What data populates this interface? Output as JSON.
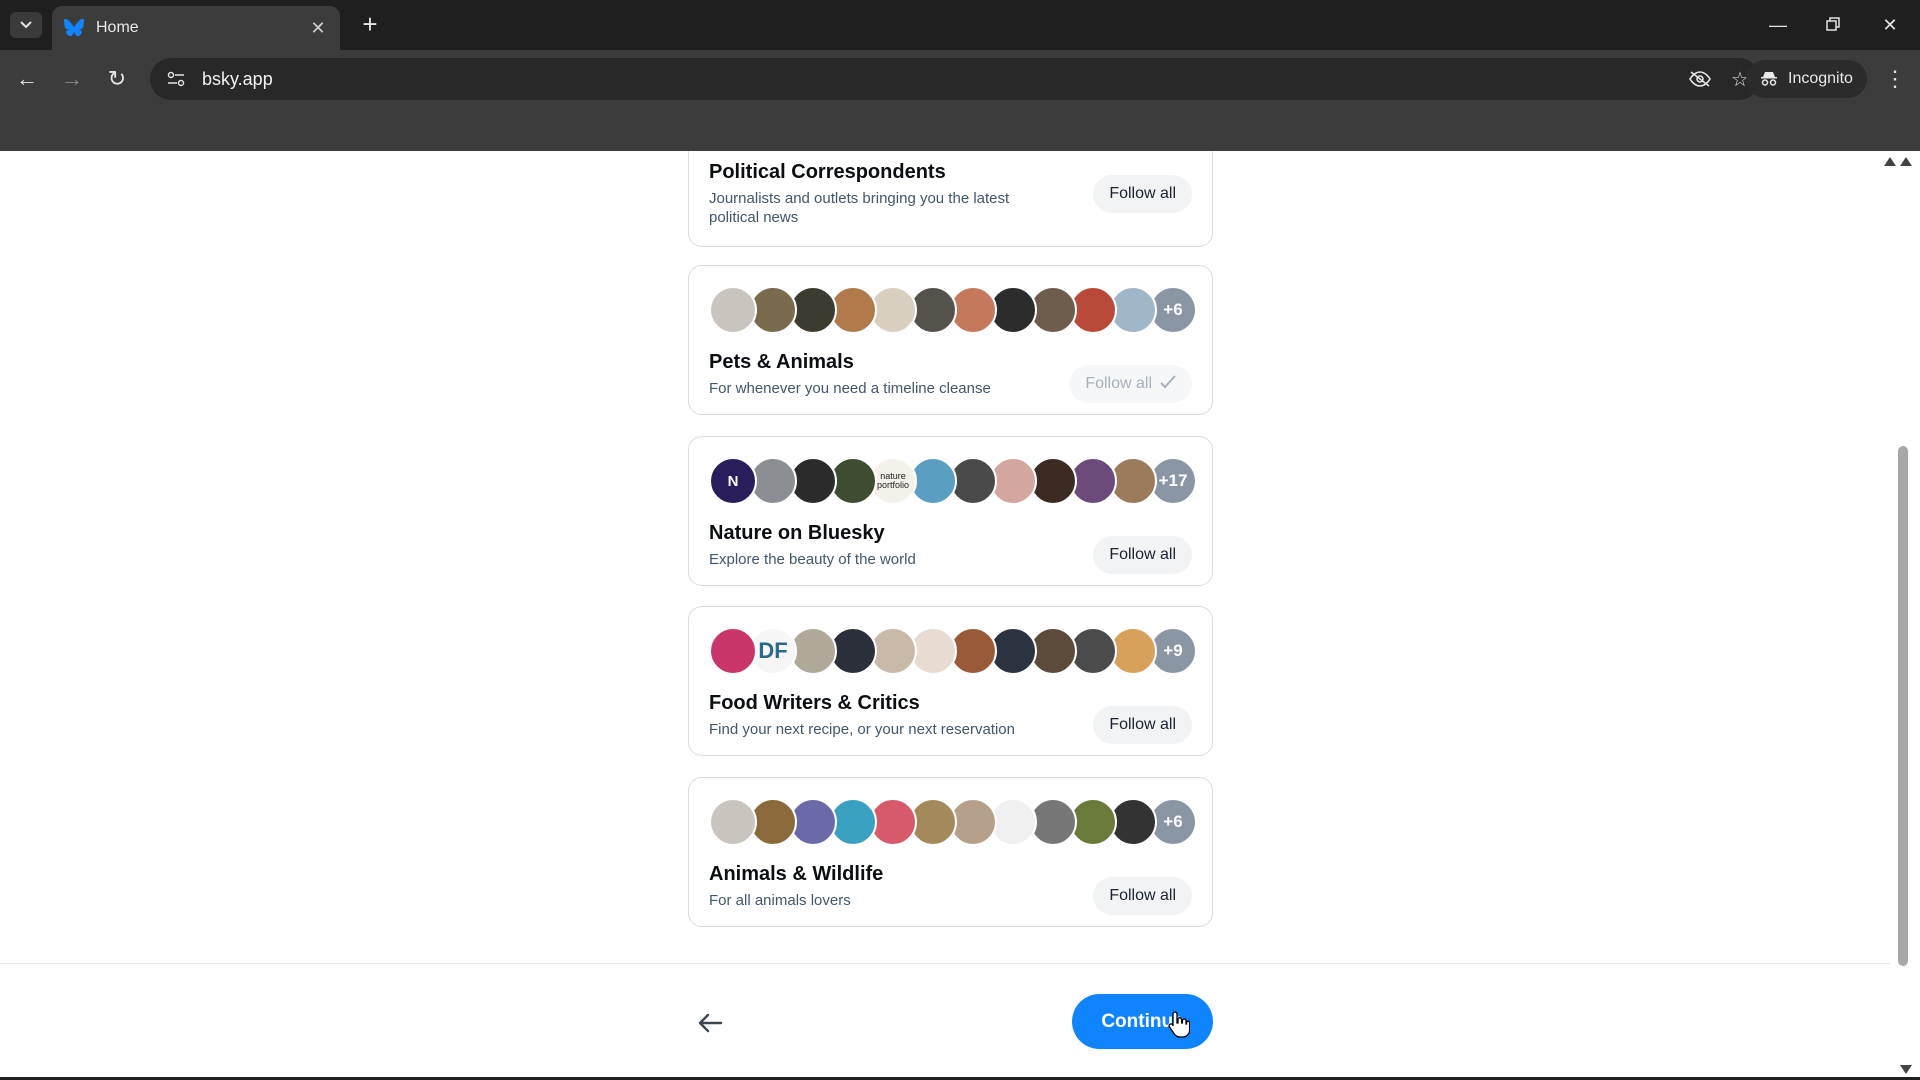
{
  "browser": {
    "tab_title": "Home",
    "url": "bsky.app",
    "incognito_label": "Incognito"
  },
  "colors": {
    "accent": "#1083fe",
    "chrome_dark": "#1f1f1f",
    "chrome_toolbar": "#3c3c3c"
  },
  "lists": [
    {
      "title": "Political Correspondents",
      "description": "Journalists and outlets bringing you the latest political news",
      "follow_label": "Follow all",
      "followed": false,
      "avatars": [],
      "more_count": ""
    },
    {
      "title": "Pets & Animals",
      "description": "For whenever you need a timeline cleanse",
      "follow_label": "Follow all",
      "followed": true,
      "avatars": [
        "#c9c4bd",
        "#7a6a4e",
        "#3d3a2f",
        "#b07a4a",
        "#d8cfc0",
        "#55524c",
        "#c4785c",
        "#2c2c2c",
        "#6d5c4b",
        "#b94a3a",
        "#9fb7c9"
      ],
      "more_count": "+6"
    },
    {
      "title": "Nature on Bluesky",
      "description": "Explore the beauty of the world",
      "follow_label": "Follow all",
      "followed": false,
      "avatars": [
        "#2a1d5c",
        "#8b8f93",
        "#2b2b2b",
        "#3e4d32",
        "#f4f1ea",
        "#5a9ec2",
        "#4a4a4a",
        "#d4a6a0",
        "#3b2b22",
        "#6c4b7a",
        "#9c7a5c"
      ],
      "avatar_text": [
        "N",
        "",
        "",
        "",
        "nature portfolio",
        "",
        "",
        "",
        "",
        "",
        ""
      ],
      "more_count": "+17"
    },
    {
      "title": "Food Writers & Critics",
      "description": "Find your next recipe, or your next reservation",
      "follow_label": "Follow all",
      "followed": false,
      "avatars": [
        "#c7356b",
        "#f6f6f6",
        "#b0a898",
        "#2a2f3a",
        "#c9b9a9",
        "#e8dcd2",
        "#9a5a3a",
        "#2b3340",
        "#5c4a3a",
        "#4b4b4b",
        "#d7a15b"
      ],
      "avatar_text": [
        "",
        "DF",
        "",
        "",
        "",
        "",
        "",
        "",
        "",
        "",
        ""
      ],
      "more_count": "+9"
    },
    {
      "title": "Animals & Wildlife",
      "description": "For all animals lovers",
      "follow_label": "Follow all",
      "followed": false,
      "avatars": [
        "#c9c4bd",
        "#8a6a3a",
        "#6a6aa8",
        "#3aa0c0",
        "#d65a6a",
        "#a48a5a",
        "#b6a08c",
        "#f0f0f0",
        "#777777",
        "#6a7a3a",
        "#333333"
      ],
      "more_count": "+6"
    }
  ],
  "footer": {
    "continue_label": "Continue"
  }
}
